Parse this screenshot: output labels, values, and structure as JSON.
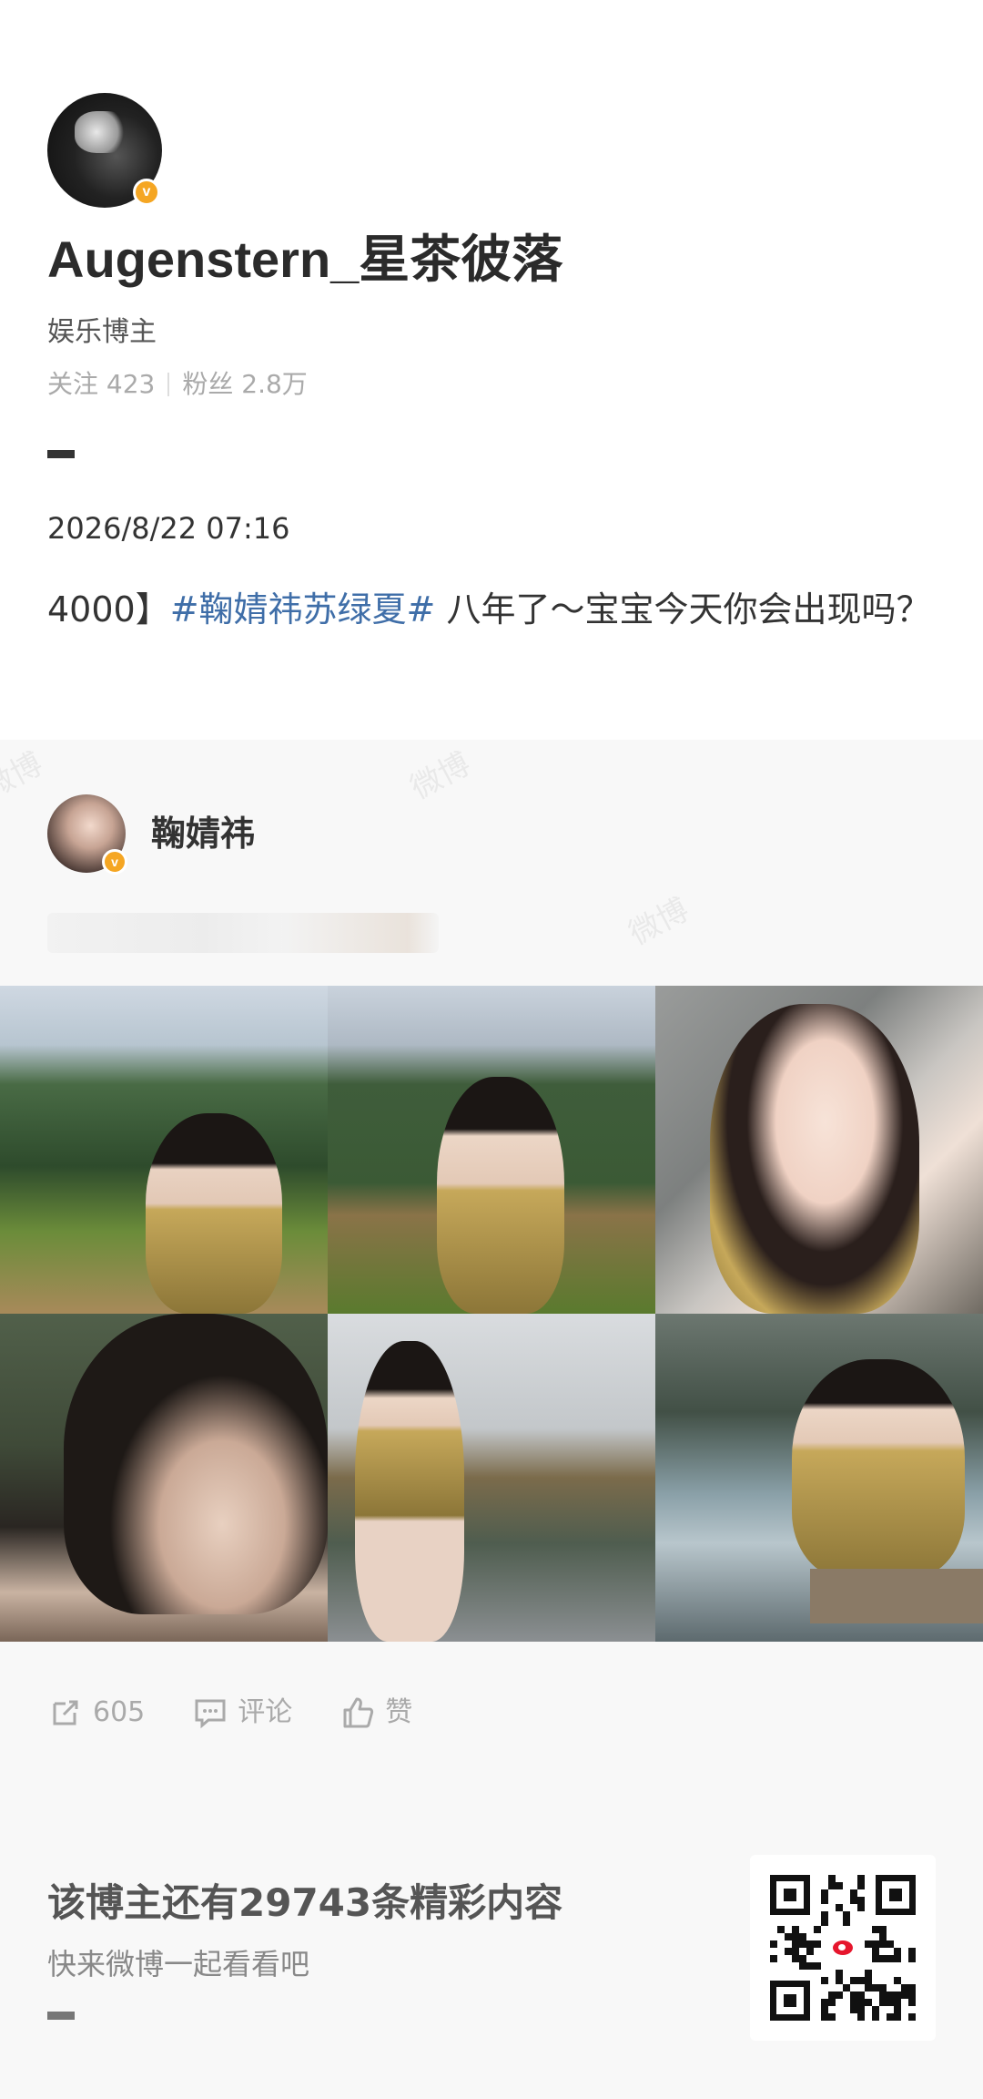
{
  "author": {
    "username": "Augenstern_星茶彼落",
    "role": "娱乐博主",
    "stats": {
      "following_label": "关注 423",
      "followers_label": "粉丝 2.8万"
    }
  },
  "post": {
    "date": "2026/8/22 07:16",
    "text_prefix": "4000】",
    "hashtag": "#鞠婧祎苏绿夏#",
    "text_suffix": " 八年了～宝宝今天你会出现吗？"
  },
  "repost": {
    "original_author": "鞠婧祎",
    "photos": [
      "photo-1",
      "photo-2",
      "photo-3",
      "photo-4",
      "photo-5",
      "photo-6"
    ]
  },
  "actions": {
    "share_count": "605",
    "comment_label": "评论",
    "like_label": "赞"
  },
  "footer": {
    "title": "该博主还有29743条精彩内容",
    "subtitle": "快来微博一起看看吧"
  },
  "watermark": "微博",
  "colors": {
    "hashtag": "#3f6ea8",
    "verified_badge": "#f5a623",
    "weibo_red": "#e6162d"
  },
  "icons": [
    "share-icon",
    "comment-icon",
    "like-icon",
    "verified-badge-icon",
    "qr-code-icon"
  ]
}
